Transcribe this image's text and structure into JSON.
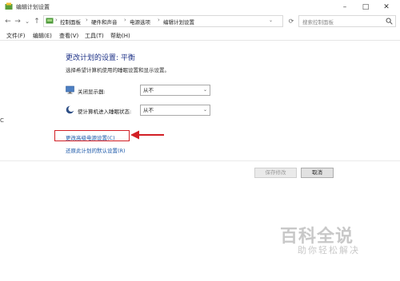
{
  "window": {
    "title": "编辑计划设置",
    "minimize": "–",
    "maximize": "□",
    "close": "✕"
  },
  "nav": {
    "back": "←",
    "forward": "→",
    "recent": "⌄",
    "up": "↑",
    "breadcrumbs": [
      "控制面板",
      "硬件和声音",
      "电源选项",
      "编辑计划设置"
    ],
    "separator": "›",
    "refresh": "⟳",
    "search_placeholder": "搜索控制面板"
  },
  "menu": {
    "items": [
      "文件(F)",
      "编辑(E)",
      "查看(V)",
      "工具(T)",
      "帮助(H)"
    ]
  },
  "content": {
    "title": "更改计划的设置: 平衡",
    "description": "选择希望计算机使用的睡眠设置和显示设置。",
    "settings": [
      {
        "label": "关闭显示器:",
        "value": "从不",
        "icon": "monitor-icon"
      },
      {
        "label": "使计算机进入睡眠状态:",
        "value": "从不",
        "icon": "moon-icon"
      }
    ],
    "advanced_link": "更改高级电源设置(C)",
    "restore_link": "还原此计划的默认设置(R)",
    "save_button": "保存修改",
    "cancel_button": "取消"
  },
  "left_edge_label": "C",
  "watermark": {
    "main": "百科全说",
    "sub": "助你轻松解决"
  },
  "colors": {
    "title": "#1e3287",
    "link": "#1a57a8",
    "highlight": "#d21f25"
  }
}
